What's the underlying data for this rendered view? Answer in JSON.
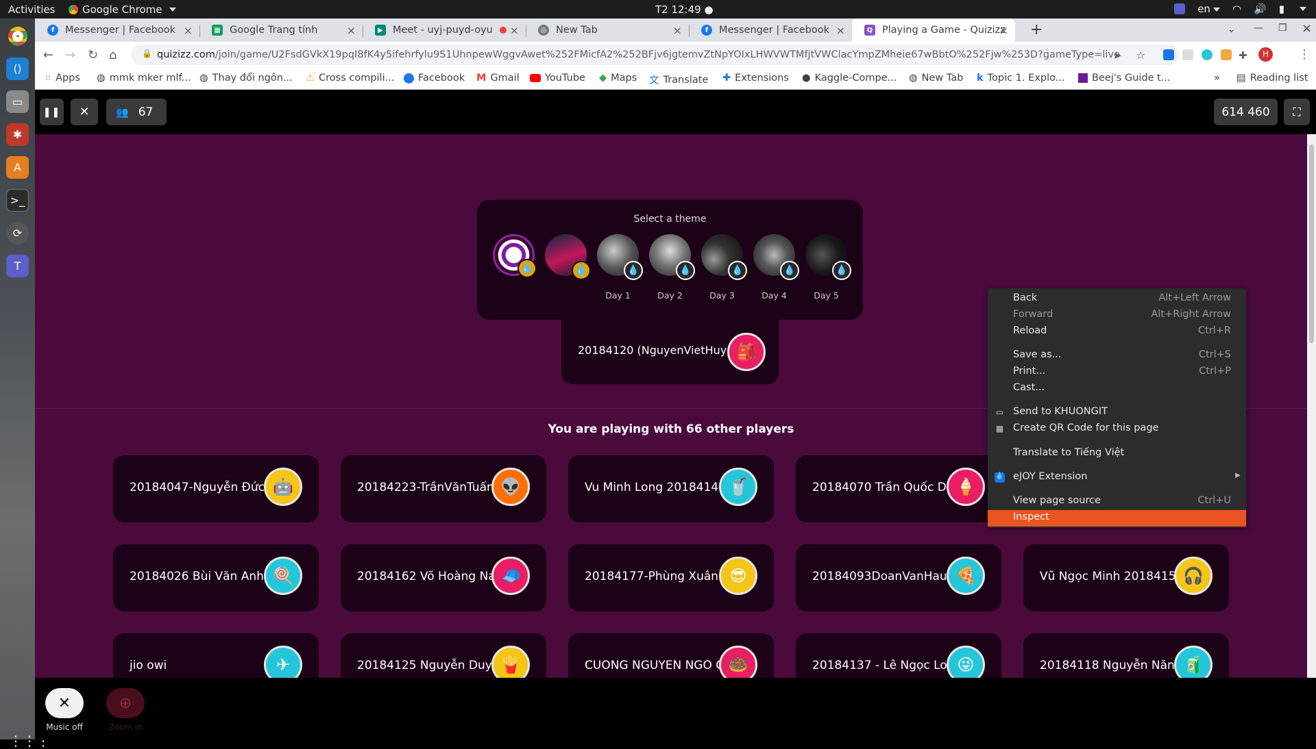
{
  "system": {
    "activities": "Activities",
    "app_name": "Google Chrome",
    "clock": "T2 12:49 ●",
    "lang": "en"
  },
  "tabs": [
    {
      "title": "Messenger | Facebook",
      "icon": "facebook-icon"
    },
    {
      "title": "Google Trang tính",
      "icon": "sheets-icon"
    },
    {
      "title": "Meet - uyj-puyd-oyu",
      "icon": "meet-icon"
    },
    {
      "title": "New Tab",
      "icon": "chrome-icon"
    },
    {
      "title": "Messenger | Facebook",
      "icon": "facebook-icon"
    },
    {
      "title": "Playing a Game - Quizizz",
      "icon": "quizizz-icon",
      "active": true
    }
  ],
  "new_tab": "+",
  "address": {
    "domain": "quizizz.com",
    "path": "/join/game/U2FsdGVkX19pqI8fK4y5ifehrfylu9S1UhnpewWggvAwet%252FMicfA2%252BFjv6jgtemvZtNpYOIxLHWVWTMfjtVWClacYmpZMheie67wBbtO%252Fjw%253D?gameType=live"
  },
  "profile_initial": "H",
  "bookmarks": [
    {
      "label": "Apps",
      "icon": "apps-grid-icon"
    },
    {
      "label": "mmk mker mlf...",
      "icon": "globe-icon"
    },
    {
      "label": "Thay đổi ngôn...",
      "icon": "globe-icon"
    },
    {
      "label": "Cross compili...",
      "icon": "warning-icon"
    },
    {
      "label": "Facebook",
      "icon": "facebook-icon"
    },
    {
      "label": "Gmail",
      "icon": "gmail-icon"
    },
    {
      "label": "YouTube",
      "icon": "youtube-icon"
    },
    {
      "label": "Maps",
      "icon": "maps-icon"
    },
    {
      "label": "Translate",
      "icon": "translate-icon"
    },
    {
      "label": "Extensions",
      "icon": "extensions-icon"
    },
    {
      "label": "Kaggle-Compe...",
      "icon": "github-icon"
    },
    {
      "label": "New Tab",
      "icon": "globe-icon"
    },
    {
      "label": "Topic 1. Explo...",
      "icon": "k-icon"
    },
    {
      "label": "Beej's Guide t...",
      "icon": "book-icon"
    }
  ],
  "bookmarks_more": "»",
  "reading_list": "Reading list",
  "game": {
    "player_count": "67",
    "score": "614 460",
    "theme_title": "Select a theme",
    "theme_days": [
      "Day 1",
      "Day 2",
      "Day 3",
      "Day 4",
      "Day 5"
    ],
    "me": "20184120 (NguyenVietHuy)",
    "playing_with": "You are playing with 66 other players",
    "players": [
      "20184047-Nguyễn Đức E",
      "20184223-TrầnVănTuấn",
      "Vu Minh Long 20184144",
      "20184070 Trần Quốc Du",
      "20184026 Bùi Văn Anh",
      "20184162 Võ Hoàng Nar",
      "20184177-Phùng Xuân Q",
      "20184093DoanVanHau",
      "Vũ Ngọc Minh 20184156",
      "jio owi",
      "20184125 Nguyễn Duy K",
      "CUONG NGUYEN NGO C",
      "20184137 - Lê Ngọc Long",
      "20184118 Nguyễn Năng I"
    ],
    "music_label": "Music off",
    "zoom_label": "Zoom in"
  },
  "context_menu": [
    {
      "label": "Back",
      "shortcut": "Alt+Left Arrow"
    },
    {
      "label": "Forward",
      "shortcut": "Alt+Right Arrow",
      "disabled": true
    },
    {
      "label": "Reload",
      "shortcut": "Ctrl+R"
    },
    {
      "label": "Save as...",
      "shortcut": "Ctrl+S"
    },
    {
      "label": "Print...",
      "shortcut": "Ctrl+P"
    },
    {
      "label": "Cast...",
      "shortcut": ""
    },
    {
      "label": "Send to KHUONGIT",
      "shortcut": "",
      "icon": "monitor-icon"
    },
    {
      "label": "Create QR Code for this page",
      "shortcut": "",
      "icon": "qr-code-icon"
    },
    {
      "label": "Translate to Tiếng Việt",
      "shortcut": ""
    },
    {
      "label": "eJOY Extension",
      "shortcut": "",
      "icon": "ejoy-icon",
      "submenu": true
    },
    {
      "label": "View page source",
      "shortcut": "Ctrl+U"
    },
    {
      "label": "Inspect",
      "shortcut": "",
      "highlighted": true
    }
  ],
  "colors": {
    "page_bg": "#4a0a3c",
    "card_bg": "#1c0217",
    "menu_highlight": "#e95420"
  }
}
